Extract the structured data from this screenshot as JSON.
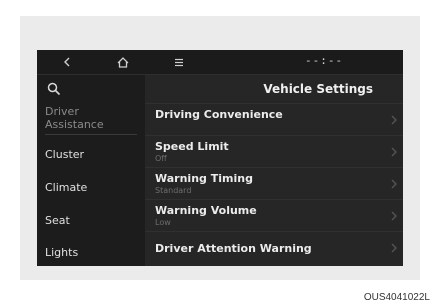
{
  "topbar": {
    "back_icon": "back-chevron-icon",
    "home_icon": "home-icon",
    "menu_icon": "menu-icon",
    "clock": "--:--"
  },
  "sidebar": {
    "search_icon": "search-icon",
    "items": [
      {
        "label_line1": "Driver",
        "label_line2": "Assistance",
        "active": true
      },
      {
        "label": "Cluster"
      },
      {
        "label": "Climate"
      },
      {
        "label": "Seat"
      },
      {
        "label": "Lights"
      }
    ]
  },
  "main": {
    "title": "Vehicle Settings",
    "rows": [
      {
        "label": "Driving Convenience",
        "value": ""
      },
      {
        "label": "Speed Limit",
        "value": "Off"
      },
      {
        "label": "Warning Timing",
        "value": "Standard"
      },
      {
        "label": "Warning Volume",
        "value": "Low"
      },
      {
        "label": "Driver Attention Warning",
        "value": ""
      }
    ]
  },
  "caption": "OUS4041022L"
}
